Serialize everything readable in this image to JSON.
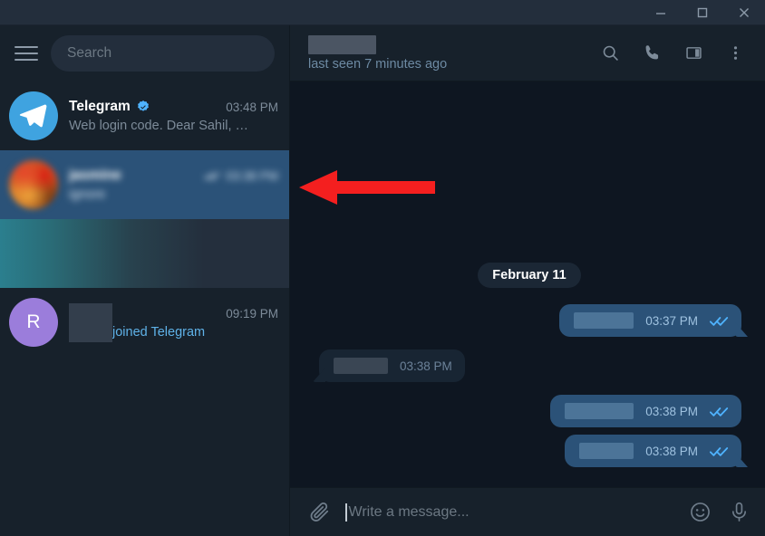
{
  "window": {
    "minimize_label": "Minimize",
    "maximize_label": "Maximize",
    "close_label": "Close"
  },
  "sidebar": {
    "menu_icon": "hamburger-menu-icon",
    "search": {
      "placeholder": "Search",
      "value": ""
    },
    "chats": [
      {
        "name": "Telegram",
        "verified": true,
        "time": "03:48 PM",
        "preview": "Web login code. Dear Sahil, …",
        "avatar_kind": "telegram-logo",
        "avatar_letter": "",
        "selected": false,
        "redacted": false,
        "ticks": false
      },
      {
        "name": "jasmine",
        "verified": false,
        "time": "03:38 PM",
        "preview": "ignore",
        "avatar_kind": "photo",
        "avatar_letter": "",
        "selected": true,
        "redacted": true,
        "ticks": true
      },
      {
        "name": "",
        "verified": false,
        "time": "",
        "preview": "",
        "avatar_kind": "hidden",
        "avatar_letter": "",
        "selected": false,
        "redacted": "full-bar",
        "ticks": false
      },
      {
        "name": "",
        "verified": false,
        "time": "09:19 PM",
        "preview": "joined Telegram",
        "avatar_kind": "letter",
        "avatar_letter": "R",
        "selected": false,
        "redacted": "name-box",
        "ticks": false
      }
    ]
  },
  "chat": {
    "title": "",
    "title_redacted": true,
    "status": "last seen 7 minutes ago",
    "actions": [
      {
        "icon": "search-icon",
        "label": "Search messages"
      },
      {
        "icon": "phone-icon",
        "label": "Call"
      },
      {
        "icon": "panel-toggle-icon",
        "label": "Toggle info panel"
      },
      {
        "icon": "more-vertical-icon",
        "label": "More options"
      }
    ],
    "date_separator": "February 11",
    "messages": [
      {
        "direction": "out",
        "text": "",
        "redacted_width": 66,
        "time": "03:37 PM",
        "status_ticks": "read",
        "tail": true
      },
      {
        "direction": "in",
        "text": "",
        "redacted_width": 60,
        "time": "03:38 PM",
        "status_ticks": "none",
        "tail": true
      },
      {
        "direction": "out",
        "text": "",
        "redacted_width": 76,
        "time": "03:38 PM",
        "status_ticks": "read",
        "tail": false
      },
      {
        "direction": "out",
        "text": "",
        "redacted_width": 60,
        "time": "03:38 PM",
        "status_ticks": "read",
        "tail": true
      }
    ]
  },
  "composer": {
    "attach_icon": "paperclip-icon",
    "placeholder": "Write a message...",
    "value": "",
    "emoji_icon": "smiley-icon",
    "mic_icon": "microphone-icon"
  },
  "annotation": {
    "arrow_color": "#f41f1f",
    "arrow_direction": "left",
    "points_at": "selected chat row"
  },
  "colors": {
    "sidebar_bg": "#17212b",
    "chat_bg": "#0e1621",
    "selected_row": "#2b5278",
    "out_bubble": "#2b5278",
    "in_bubble": "#182533",
    "accent_blue": "#3fa3e0",
    "link_blue": "#5fb2e8",
    "tick_blue": "#4fb3ff"
  }
}
